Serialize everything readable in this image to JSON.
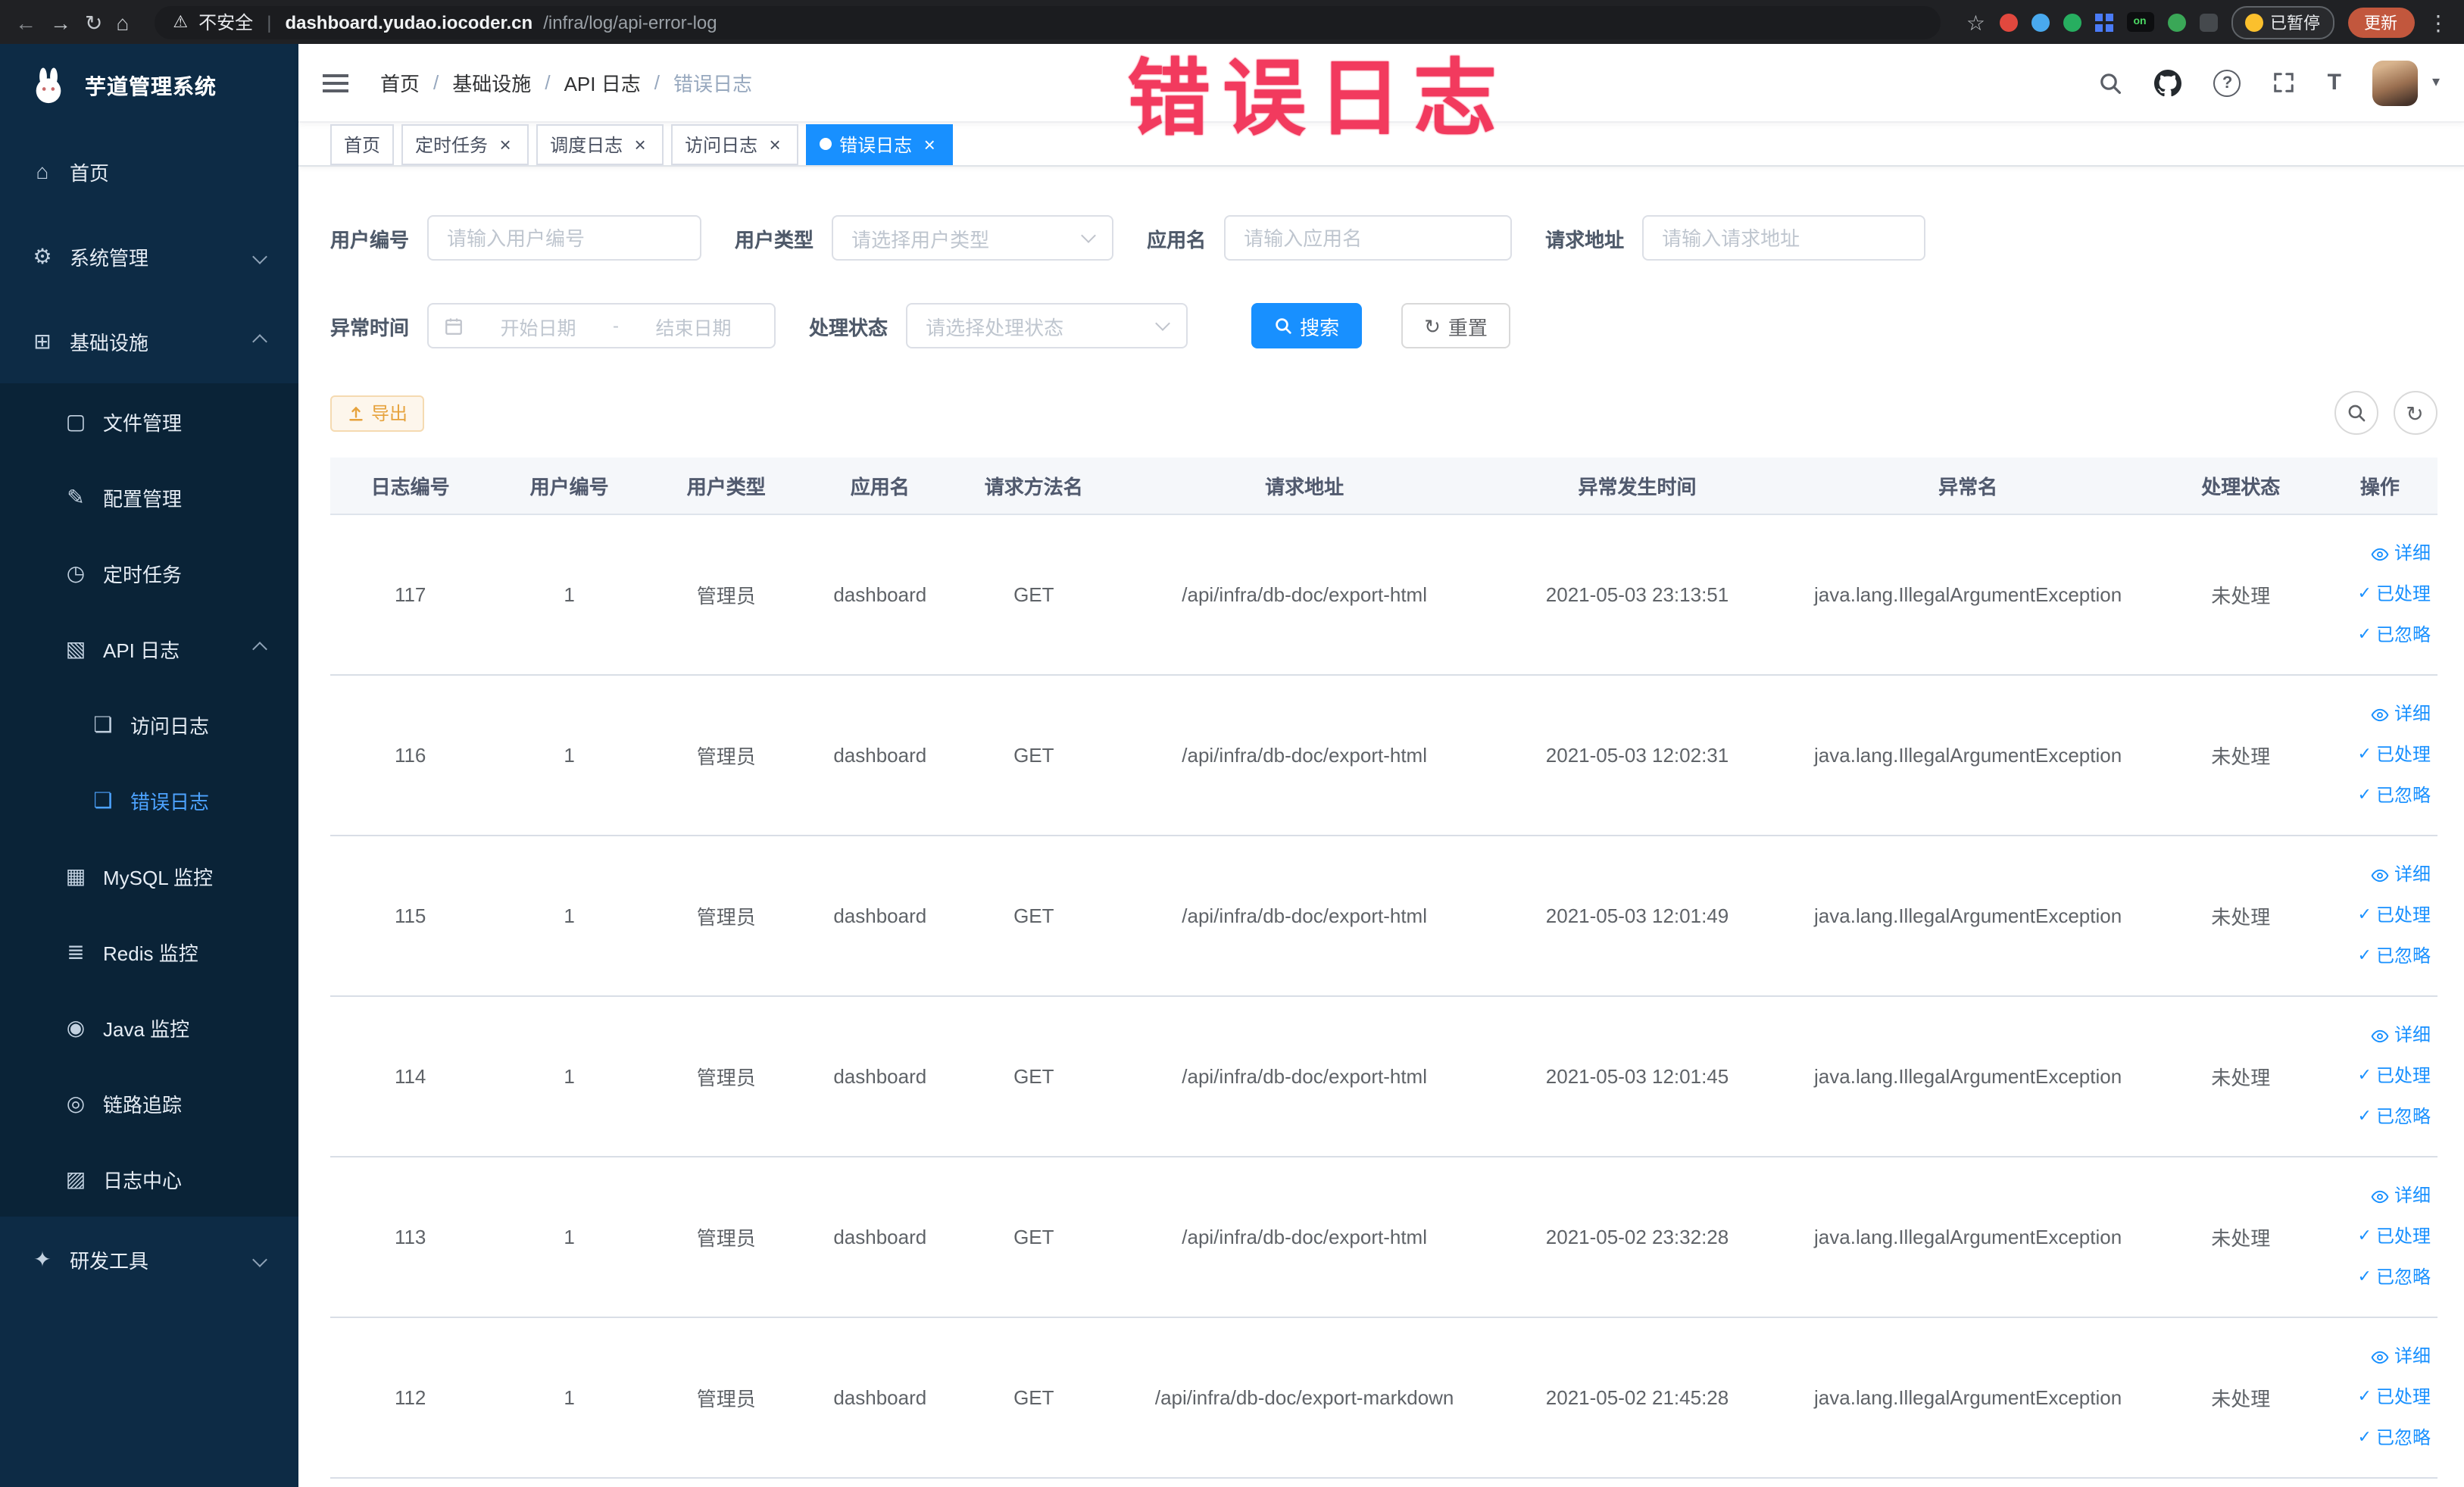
{
  "watermark": "错误日志",
  "colors": {
    "accent_blue": "#1890ff",
    "sidebar_bg": "#0d2b45",
    "export_orange": "#e6a23c",
    "annotation_red": "#f23a5e"
  },
  "browser": {
    "warning": "不安全",
    "url_domain": "dashboard.yudao.iocoder.cn",
    "url_path": "/infra/log/api-error-log",
    "paused_badge": "已暂停",
    "update_button": "更新"
  },
  "sidebar": {
    "logo": "芋道管理系统",
    "menu": [
      {
        "label": "首页",
        "icon": "home-icon",
        "level": 0
      },
      {
        "label": "系统管理",
        "icon": "gear-icon",
        "level": 0,
        "chevron": "down"
      },
      {
        "label": "基础设施",
        "icon": "infra-icon",
        "level": 0,
        "chevron": "up"
      },
      {
        "label": "文件管理",
        "icon": "file-icon",
        "level": 1
      },
      {
        "label": "配置管理",
        "icon": "config-icon",
        "level": 1
      },
      {
        "label": "定时任务",
        "icon": "task-icon",
        "level": 1
      },
      {
        "label": "API 日志",
        "icon": "api-log-icon",
        "level": 1,
        "chevron": "up"
      },
      {
        "label": "访问日志",
        "icon": "doc-icon",
        "level": 2
      },
      {
        "label": "错误日志",
        "icon": "doc-icon",
        "level": 2,
        "active": true
      },
      {
        "label": "MySQL 监控",
        "icon": "mysql-icon",
        "level": 1
      },
      {
        "label": "Redis 监控",
        "icon": "redis-icon",
        "level": 1
      },
      {
        "label": "Java 监控",
        "icon": "java-icon",
        "level": 1
      },
      {
        "label": "链路追踪",
        "icon": "trace-icon",
        "level": 1
      },
      {
        "label": "日志中心",
        "icon": "log-center-icon",
        "level": 1
      },
      {
        "label": "研发工具",
        "icon": "tools-icon",
        "level": 0,
        "chevron": "down"
      }
    ]
  },
  "breadcrumb": [
    "首页",
    "基础设施",
    "API 日志",
    "错误日志"
  ],
  "tabs": [
    {
      "label": "首页",
      "closable": false,
      "active": false
    },
    {
      "label": "定时任务",
      "closable": true,
      "active": false
    },
    {
      "label": "调度日志",
      "closable": true,
      "active": false
    },
    {
      "label": "访问日志",
      "closable": true,
      "active": false
    },
    {
      "label": "错误日志",
      "closable": true,
      "active": true
    }
  ],
  "filters": {
    "user_id": {
      "label": "用户编号",
      "placeholder": "请输入用户编号"
    },
    "user_type": {
      "label": "用户类型",
      "placeholder": "请选择用户类型"
    },
    "app_name": {
      "label": "应用名",
      "placeholder": "请输入应用名"
    },
    "request_url": {
      "label": "请求地址",
      "placeholder": "请输入请求地址"
    },
    "exception_time": {
      "label": "异常时间",
      "start_placeholder": "开始日期",
      "separator": "-",
      "end_placeholder": "结束日期"
    },
    "process_status": {
      "label": "处理状态",
      "placeholder": "请选择处理状态"
    },
    "search_button": "搜索",
    "reset_button": "重置"
  },
  "toolbar": {
    "export_button": "导出"
  },
  "table": {
    "columns": [
      "日志编号",
      "用户编号",
      "用户类型",
      "应用名",
      "请求方法名",
      "请求地址",
      "异常发生时间",
      "异常名",
      "处理状态",
      "操作"
    ],
    "actions": [
      "详细",
      "已处理",
      "已忽略"
    ],
    "rows": [
      {
        "id": "117",
        "user_id": "1",
        "user_type": "管理员",
        "app": "dashboard",
        "method": "GET",
        "url": "/api/infra/db-doc/export-html",
        "time": "2021-05-03 23:13:51",
        "exception": "java.lang.IllegalArgumentException",
        "status": "未处理"
      },
      {
        "id": "116",
        "user_id": "1",
        "user_type": "管理员",
        "app": "dashboard",
        "method": "GET",
        "url": "/api/infra/db-doc/export-html",
        "time": "2021-05-03 12:02:31",
        "exception": "java.lang.IllegalArgumentException",
        "status": "未处理"
      },
      {
        "id": "115",
        "user_id": "1",
        "user_type": "管理员",
        "app": "dashboard",
        "method": "GET",
        "url": "/api/infra/db-doc/export-html",
        "time": "2021-05-03 12:01:49",
        "exception": "java.lang.IllegalArgumentException",
        "status": "未处理"
      },
      {
        "id": "114",
        "user_id": "1",
        "user_type": "管理员",
        "app": "dashboard",
        "method": "GET",
        "url": "/api/infra/db-doc/export-html",
        "time": "2021-05-03 12:01:45",
        "exception": "java.lang.IllegalArgumentException",
        "status": "未处理"
      },
      {
        "id": "113",
        "user_id": "1",
        "user_type": "管理员",
        "app": "dashboard",
        "method": "GET",
        "url": "/api/infra/db-doc/export-html",
        "time": "2021-05-02 23:32:28",
        "exception": "java.lang.IllegalArgumentException",
        "status": "未处理"
      },
      {
        "id": "112",
        "user_id": "1",
        "user_type": "管理员",
        "app": "dashboard",
        "method": "GET",
        "url": "/api/infra/db-doc/export-markdown",
        "time": "2021-05-02 21:45:28",
        "exception": "java.lang.IllegalArgumentException",
        "status": "未处理"
      }
    ]
  }
}
